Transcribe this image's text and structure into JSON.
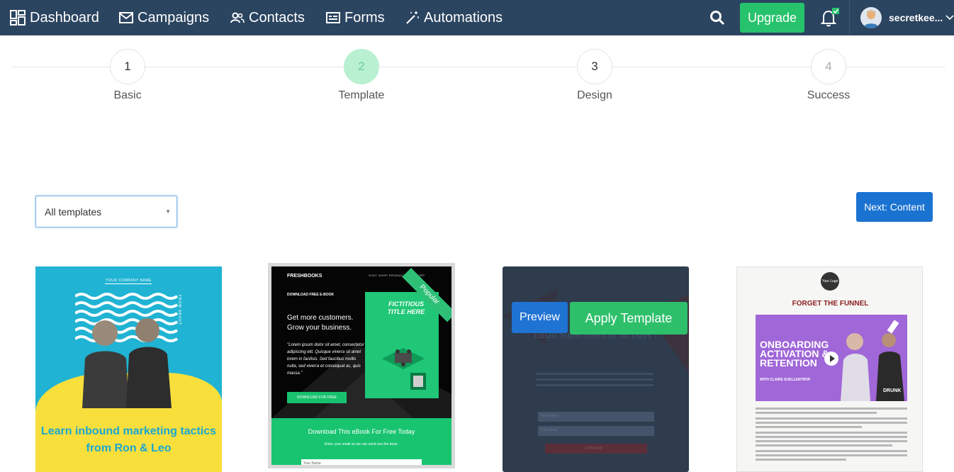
{
  "nav": {
    "dashboard": "Dashboard",
    "campaigns": "Campaigns",
    "contacts": "Contacts",
    "forms": "Forms",
    "automations": "Automations",
    "upgrade": "Upgrade",
    "username": "secretkee..."
  },
  "colors": {
    "nav_bg": "#2b4460",
    "upgrade_green": "#27c26c",
    "primary_blue": "#1b73d1",
    "step_active": "#b8f0d1"
  },
  "stepper": {
    "steps": [
      {
        "number": "1",
        "label": "Basic"
      },
      {
        "number": "2",
        "label": "Template"
      },
      {
        "number": "3",
        "label": "Design"
      },
      {
        "number": "4",
        "label": "Success"
      }
    ],
    "active_step": 2
  },
  "filter": {
    "selected": "All templates"
  },
  "actions": {
    "next": "Next: Content"
  },
  "templates": [
    {
      "company": "YOUR COMPANY NAME",
      "side_text": "FROM ABOUT",
      "headline": "Learn inbound marketing tactics from Ron & Leo"
    },
    {
      "badge": "Popular",
      "logo": "FRESHBOOKS",
      "menu": "VISIT SHOP   PRODUCTS   SUPPORT",
      "label": "DOWNLOAD FREE E-BOOK",
      "headline": "Get more customers. Grow your business.",
      "quote": "\"Lorem ipsum dolor sit amet, consectetur adipiscing elit. Quisque viverra sit amet lorem in facilisis. Sed faucibus mollis nulla, sed viverra et consequat ac, quis massa.\"",
      "button": "DOWNLOAD FOR FREE",
      "feature_title": "FICTITIOUS TITLE HERE",
      "bottom_title": "Download This eBook For Free Today",
      "bottom_sub": "Enter your email so we can send you the book.",
      "input_placeholder": "Your Name"
    },
    {
      "title": "Email Subscribers in 30 Days ?",
      "field1": "Your Name",
      "field2": "Your Email",
      "join": "JOIN NOW →",
      "preview": "Preview",
      "apply": "Apply Template"
    },
    {
      "logo": "Your Logo",
      "title": "FORGET THE FUNNEL",
      "banner": "ONBOARDING ACTIVATION & RETENTION",
      "with": "WITH CLAIRE SUELLENTROP",
      "brand": "DRUNK"
    }
  ]
}
